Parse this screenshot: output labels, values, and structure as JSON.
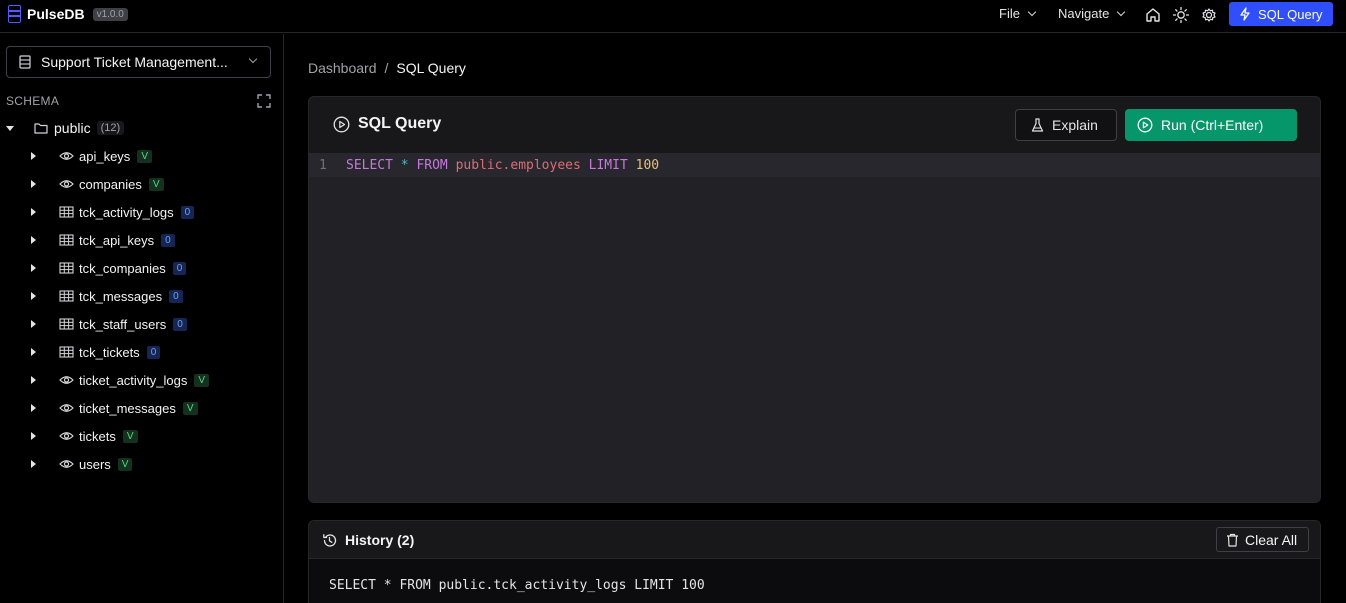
{
  "app": {
    "name": "PulseDB",
    "version": "v1.0.0"
  },
  "menu": {
    "file": "File",
    "navigate": "Navigate",
    "sql_query": "SQL Query"
  },
  "sidebar": {
    "database": "Support Ticket Management...",
    "schema_label": "SCHEMA",
    "public": {
      "name": "public",
      "count": "(12)"
    },
    "items": [
      {
        "label": "api_keys",
        "type": "view-icon",
        "badge": "V"
      },
      {
        "label": "companies",
        "type": "view-icon",
        "badge": "V"
      },
      {
        "label": "tck_activity_logs",
        "type": "table-icon",
        "badge": "0"
      },
      {
        "label": "tck_api_keys",
        "type": "table-icon",
        "badge": "0"
      },
      {
        "label": "tck_companies",
        "type": "table-icon",
        "badge": "0"
      },
      {
        "label": "tck_messages",
        "type": "table-icon",
        "badge": "0"
      },
      {
        "label": "tck_staff_users",
        "type": "table-icon",
        "badge": "0"
      },
      {
        "label": "tck_tickets",
        "type": "table-icon",
        "badge": "0"
      },
      {
        "label": "ticket_activity_logs",
        "type": "view-icon",
        "badge": "V"
      },
      {
        "label": "ticket_messages",
        "type": "view-icon",
        "badge": "V"
      },
      {
        "label": "tickets",
        "type": "view-icon",
        "badge": "V"
      },
      {
        "label": "users",
        "type": "view-icon",
        "badge": "V"
      }
    ]
  },
  "breadcrumb": {
    "parent": "Dashboard",
    "separator": "/",
    "current": "SQL Query"
  },
  "editor": {
    "title": "SQL Query",
    "explain_label": "Explain",
    "run_label": "Run (Ctrl+Enter)",
    "line_number": "1",
    "tokens": {
      "select": "SELECT",
      "star": "*",
      "from": "FROM",
      "table": "public.employees",
      "limit": "LIMIT",
      "number": "100"
    }
  },
  "history": {
    "title": "History (2)",
    "clear_label": "Clear All",
    "items": [
      "SELECT * FROM public.tck_activity_logs LIMIT 100"
    ]
  },
  "colors": {
    "accent": "#2f4fff",
    "run": "#059669",
    "keyword": "#c678dd",
    "identifier": "#e06c75",
    "number": "#e5c07b"
  }
}
